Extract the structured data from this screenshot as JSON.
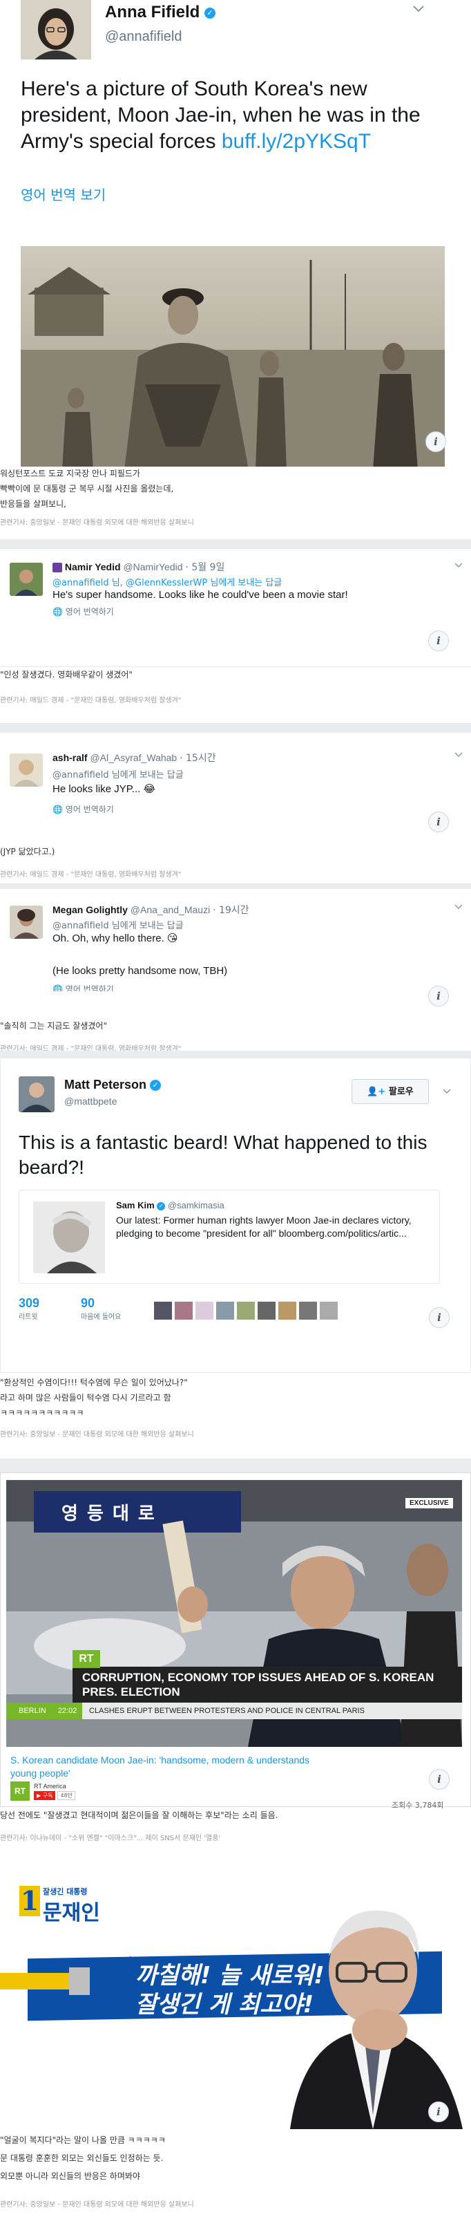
{
  "tweet1": {
    "name": "Anna Fifield",
    "handle": "@annafifield",
    "text": "Here's a picture of South Korea's new president, Moon Jae-in, when he was in the Army's special forces ",
    "link": "buff.ly/2pYKSqT",
    "translate": "영어 번역 보기"
  },
  "caption1": {
    "lines": [
      "워싱턴포스트 도쿄 지국장 안나 피필드가",
      "빡빡이에 문 대통령 군 복무 시절 사진을 올렸는데,",
      "반응들을 살펴보니,"
    ],
    "ref": "관련기사: 중앙일보 - 문재인 대통령 외모에 대한 해외반응 살펴보니"
  },
  "reply1": {
    "name": "Namir Yedid",
    "handle": "@NamirYedid",
    "time": "· 5월 9일",
    "reply_to": "@annafifield 님, @GlennKesslerWP 님에게 보내는 답글",
    "text": "He's super handsome. Looks like he could've been a movie star!",
    "translate": "영어 번역하기"
  },
  "caption2": {
    "line": "\"인성 잘생겼다. 영화배우같이 생겼어\"",
    "ref": "관련기사: 매일드 경제 - \"문재인 대통령, 영화배우처럼 잘생겨\""
  },
  "reply2": {
    "name": "ash-ralf",
    "handle": "@Al_Asyraf_Wahab",
    "time": "· 15시간",
    "reply_to": "@annafifield 님에게 보내는 답글",
    "text": "He looks like JYP... 😂",
    "translate": "영어 번역하기"
  },
  "caption3": {
    "line": "(JYP 닮았다고.)",
    "ref": "관련기사: 매일드 경제 - \"문재인 대통령, 영화배우처럼 잘생겨\""
  },
  "reply3": {
    "name": "Megan Golightly",
    "handle": "@Ana_and_Mauzi",
    "time": "· 19시간",
    "reply_to": "@annafifield 님에게 보내는 답글",
    "text1": "Oh. Oh, why hello there. 😘",
    "text2": "(He looks pretty handsome now, TBH)",
    "translate": "영어 번역하기"
  },
  "caption4": {
    "line": "\"솔직히 그는 지금도 잘생겼어\"",
    "ref": "관련기사: 매일드 경제 - \"문재인 대통령, 영화배우처럼 잘생겨\""
  },
  "tweet2": {
    "name": "Matt Peterson",
    "handle": "@mattbpete",
    "follow": "팔로우",
    "text": "This is a fantastic beard! What happened to this beard?!",
    "quote_name": "Sam Kim",
    "quote_handle": "@samkimasia",
    "quote_text": "Our latest: Former human rights lawyer Moon Jae-in declares victory, pledging to become \"president for all\" bloomberg.com/politics/artic...",
    "retweets": "309",
    "retweets_label": "리트윗",
    "likes": "90",
    "likes_label": "마음에 들어요"
  },
  "caption5": {
    "lines": [
      "\"환상적인 수염이다!!! 턱수염에 무슨 일이 있어났나?\"",
      "라고 하며 많은 사람들이 턱수염 다시 기르라고 함",
      "ㅋㅋㅋㅋㅋㅋㅋㅋㅋㅋㅋ"
    ],
    "ref": "관련기사: 중앙일보 - 문재인 대통령 외모에 대한 해외반응 살펴보니"
  },
  "video": {
    "exclusive": "EXCLUSIVE",
    "sign": "영 등 대 로",
    "logo": "RT",
    "headline": "CORRUPTION, ECONOMY TOP ISSUES AHEAD OF S. KOREAN PRES. ELECTION",
    "city": "BERLIN",
    "clock": "22:02",
    "ticker": "CLASHES ERUPT BETWEEN PROTESTERS AND POLICE IN CENTRAL PARIS",
    "title": "S. Korean candidate Moon Jae-in: 'handsome, modern & understands young people'",
    "channel": "RT America",
    "sub": "구독",
    "sub_count": "48만",
    "views": "조회수 3,784회"
  },
  "caption6": {
    "line": "당선 전에도 \"잘생겼고 현대적이며 젊은이들을 잘 이해하는 후보\"라는 소리 들음.",
    "ref": "관련기사: 이나뉴데이 - \"소위 엔젤\" \"이마스크\"... 제이 SNS서 문재인 '열풍'"
  },
  "banner": {
    "slogan_small": "잘생긴 대통령",
    "number": "1",
    "name": "문재인",
    "text1": "까칠해! 늘 새로워!",
    "text2": "잘생긴 게 최고야!"
  },
  "caption7": {
    "lines": [
      "\"얼굴이 복지다\"라는 말이 나올 만큼 ㅋㅋㅋㅋㅋ",
      "문 대통령 훈훈한 외모는 외신들도 인정하는 듯.",
      "외모뿐 아니라 외신들의 반응은 하며봐야"
    ],
    "ref": "관련기사: 중앙일보 - 문재인 대통령 외모에 대한 해외반응 살펴보니"
  },
  "colors": {
    "twitter_blue": "#1b95e0",
    "verified": "#1da1f2",
    "rt_green": "#77b82a",
    "banner_blue": "#0c4fa6"
  }
}
